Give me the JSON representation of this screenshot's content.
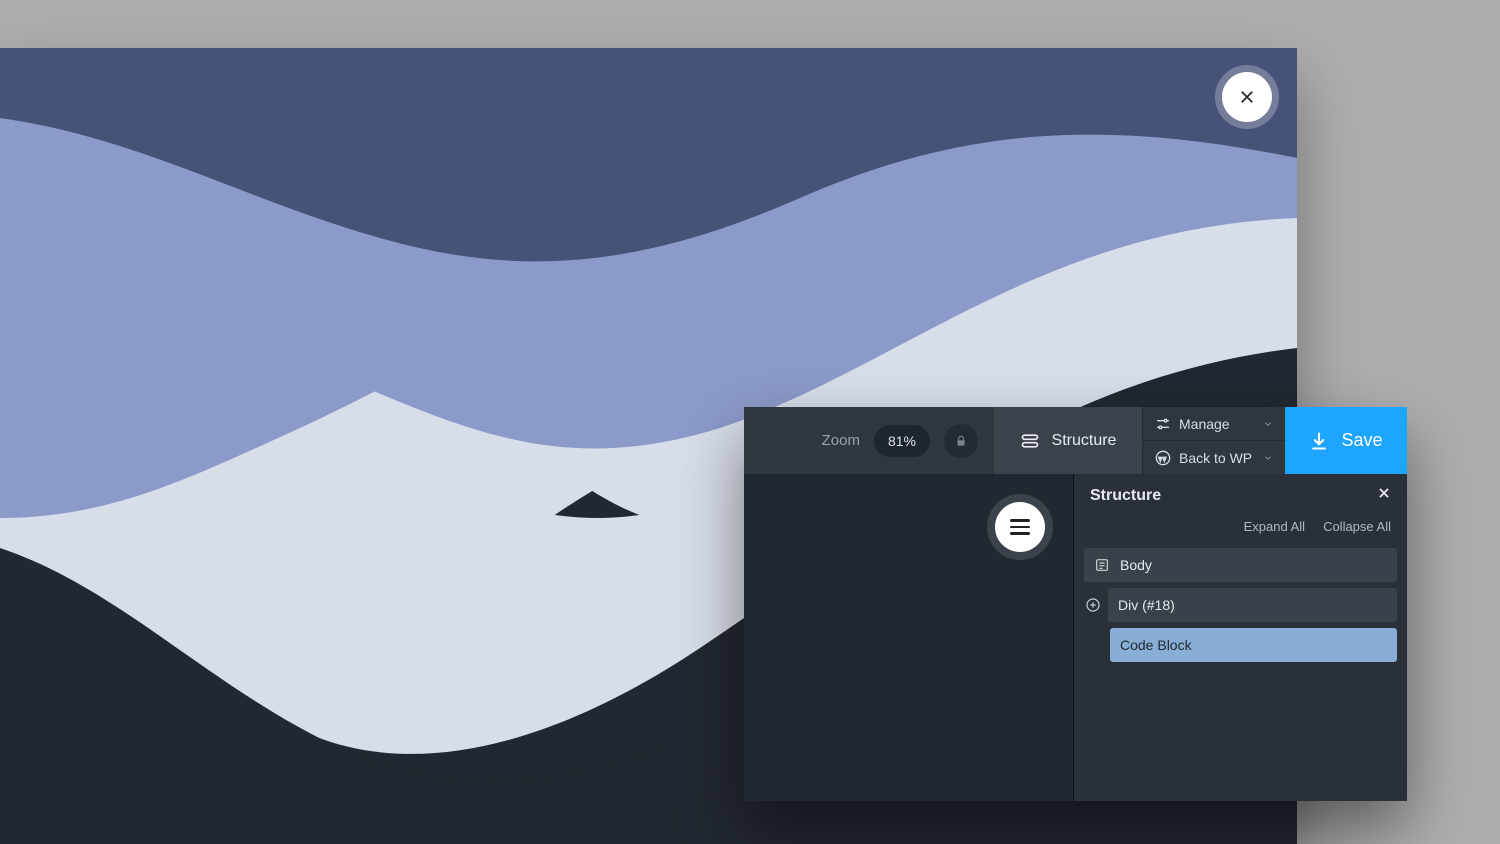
{
  "toolbar": {
    "zoom_label": "Zoom",
    "zoom_value": "81%",
    "structure_label": "Structure",
    "manage_label": "Manage",
    "back_label": "Back to WP",
    "save_label": "Save"
  },
  "panel": {
    "title": "Structure",
    "expand_all": "Expand All",
    "collapse_all": "Collapse All",
    "tree": {
      "root": "Body",
      "div": "Div (#18)",
      "code": "Code Block"
    }
  },
  "colors": {
    "wave_dark": "#475279",
    "wave_mid": "#8c9ac9",
    "wave_light": "#d7dde9",
    "canvas_dark": "#222831",
    "accent": "#1ea5ff"
  }
}
